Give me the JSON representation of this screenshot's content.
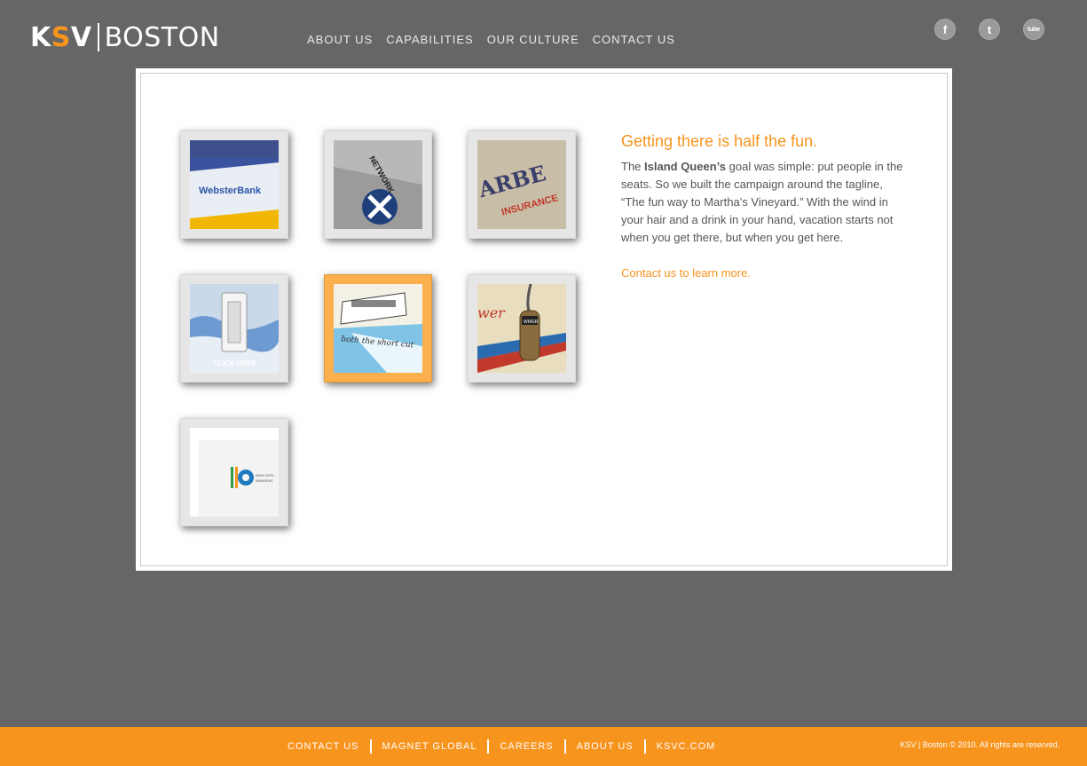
{
  "brand": {
    "ksv_k": "K",
    "ksv_s": "S",
    "ksv_v": "V",
    "city": "BOSTON",
    "accent_color": "#f7941d"
  },
  "nav": {
    "items": [
      "ABOUT US",
      "CAPABILITIES",
      "OUR CULTURE",
      "CONTACT US"
    ]
  },
  "social": {
    "facebook": "f",
    "twitter": "t",
    "youtube": "tube"
  },
  "thumbnails": [
    {
      "icon": "webster-bank-card-thumbnail",
      "caption": "WebsterBank",
      "active": false
    },
    {
      "icon": "network-card-thumbnail",
      "caption": "NETWORK",
      "active": false
    },
    {
      "icon": "barbers-insurance-thumbnail",
      "caption": "ARBE",
      "caption2": "INSURANCE",
      "active": false
    },
    {
      "icon": "light-switch-thumbnail",
      "caption": "CLICK HERE",
      "active": false
    },
    {
      "icon": "island-queen-ferry-thumbnail",
      "caption": "both the short cut",
      "active": true
    },
    {
      "icon": "radio-microphone-thumbnail",
      "caption": "wer",
      "caption2": "WMGR",
      "active": false
    },
    {
      "icon": "iic-logo-thumbnail",
      "caption": "iic",
      "caption2": "IRISH INTE",
      "caption3": "IMMIGRAT",
      "active": false
    }
  ],
  "copy": {
    "heading": "Getting there is half the fun.",
    "body_prefix": "The ",
    "body_strong": "Island Queen’s",
    "body_rest": " goal was simple: put people in the seats. So we built the campaign around the tagline, “The fun way to Martha’s Vineyard.” With the wind in your hair and a drink in your hand, vacation starts not when you get there, but when you get here.",
    "cta": "Contact us to learn more."
  },
  "footer": {
    "links": [
      "CONTACT US",
      "MAGNET GLOBAL",
      "CAREERS",
      "ABOUT US",
      "KSVC.COM"
    ],
    "copyright": "KSV | Boston © 2010. All rights are reserved."
  }
}
